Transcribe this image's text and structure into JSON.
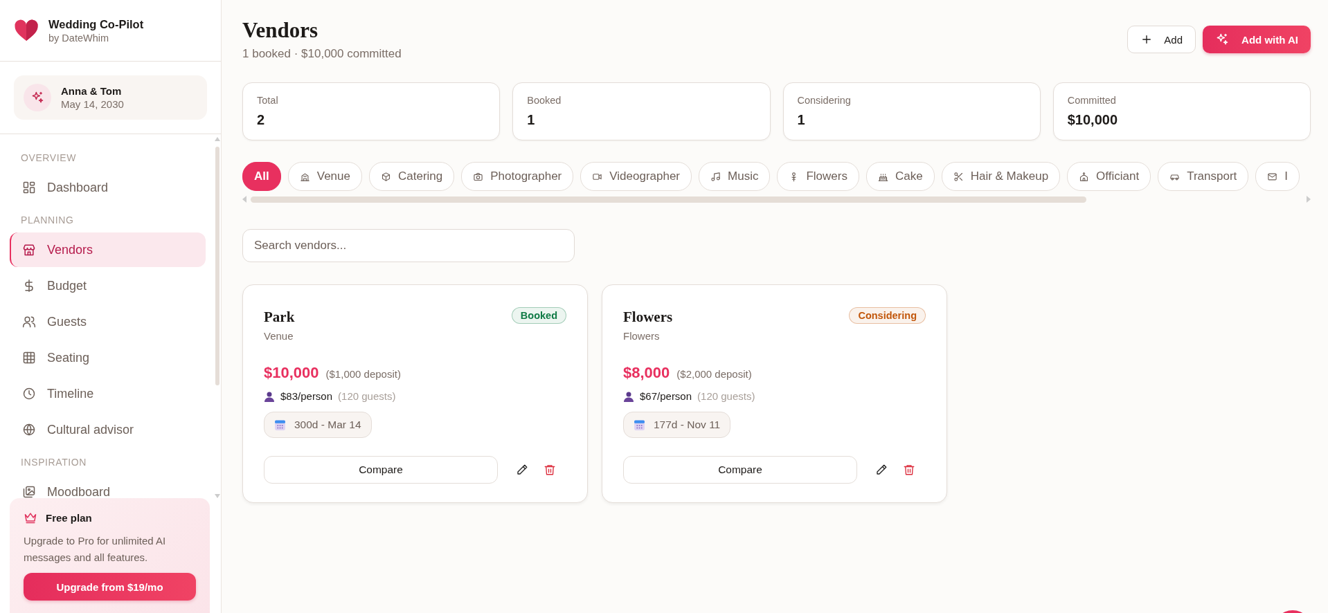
{
  "app": {
    "name": "Wedding Co-Pilot",
    "byline": "by DateWhim"
  },
  "couple": {
    "names": "Anna & Tom",
    "date": "May 14, 2030"
  },
  "nav": [
    {
      "label": "OVERVIEW",
      "items": [
        {
          "label": "Dashboard",
          "selected": false
        }
      ]
    },
    {
      "label": "PLANNING",
      "items": [
        {
          "label": "Vendors",
          "selected": true
        },
        {
          "label": "Budget",
          "selected": false
        },
        {
          "label": "Guests",
          "selected": false
        },
        {
          "label": "Seating",
          "selected": false
        },
        {
          "label": "Timeline",
          "selected": false
        },
        {
          "label": "Cultural advisor",
          "selected": false
        }
      ]
    },
    {
      "label": "INSPIRATION",
      "items": [
        {
          "label": "Moodboard",
          "selected": false
        }
      ]
    }
  ],
  "plan": {
    "title": "Free plan",
    "text": "Upgrade to Pro for unlimited AI messages and all features.",
    "button": "Upgrade from $19/mo"
  },
  "header": {
    "title": "Vendors",
    "subtitle": "1 booked · $10,000 committed",
    "buttons": [
      {
        "label": "Add",
        "kind": "outline"
      },
      {
        "label": "Add with AI",
        "kind": "primary"
      }
    ]
  },
  "stats": [
    {
      "label": "Total",
      "value": "2"
    },
    {
      "label": "Booked",
      "value": "1"
    },
    {
      "label": "Considering",
      "value": "1"
    },
    {
      "label": "Committed",
      "value": "$10,000"
    }
  ],
  "categories": [
    {
      "label": "All",
      "selected": true
    },
    {
      "label": "Venue",
      "selected": false
    },
    {
      "label": "Catering",
      "selected": false
    },
    {
      "label": "Photographer",
      "selected": false
    },
    {
      "label": "Videographer",
      "selected": false
    },
    {
      "label": "Music",
      "selected": false
    },
    {
      "label": "Flowers",
      "selected": false
    },
    {
      "label": "Cake",
      "selected": false
    },
    {
      "label": "Hair & Makeup",
      "selected": false
    },
    {
      "label": "Officiant",
      "selected": false
    },
    {
      "label": "Transport",
      "selected": false
    },
    {
      "label": "I",
      "selected": false
    }
  ],
  "search": {
    "placeholder": "Search vendors..."
  },
  "vendors": [
    {
      "name": "Park",
      "category": "Venue",
      "status": "Booked",
      "color": "#0f7a45",
      "price": "$10,000",
      "deposit": "($1,000 deposit)",
      "per_person": "$83/person",
      "guests": "(120 guests)",
      "date": "300d - Mar 14",
      "compare": "Compare"
    },
    {
      "name": "Flowers",
      "category": "Flowers",
      "status": "Considering",
      "color": "#c2570c",
      "price": "$8,000",
      "deposit": "($2,000 deposit)",
      "per_person": "$67/person",
      "guests": "(120 guests)",
      "date": "177d - Nov 11",
      "compare": "Compare"
    }
  ]
}
